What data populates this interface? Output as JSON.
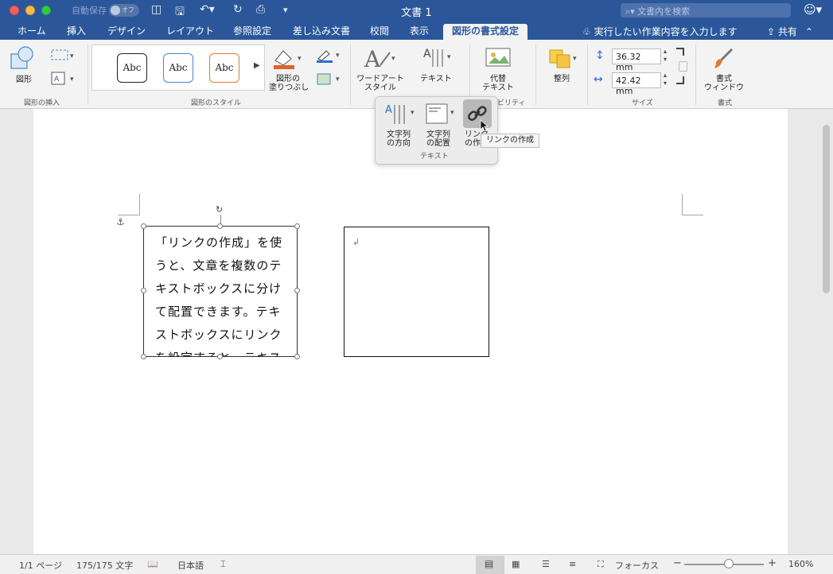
{
  "window": {
    "title": "文書 1",
    "autosave_label": "自動保存",
    "autosave_state": "オフ",
    "search_placeholder": "文書内を検索"
  },
  "tabs": [
    "ホーム",
    "挿入",
    "デザイン",
    "レイアウト",
    "参照設定",
    "差し込み文書",
    "校閲",
    "表示",
    "図形の書式設定"
  ],
  "active_tab": "図形の書式設定",
  "tell_me": "実行したい作業内容を入力します",
  "share": "共有",
  "ribbon": {
    "insert_shape": {
      "shape_label": "図形",
      "group": "図形の挿入"
    },
    "shape_styles": {
      "sample": "Abc",
      "fill_label": "図形の\n塗りつぶし",
      "group": "図形のスタイル"
    },
    "wordart_label": "ワードアート\nスタイル",
    "text_label": "テキスト",
    "alt_text_label": "代替\nテキスト",
    "accessibility_group": "ビリティ",
    "arrange_label": "整列",
    "size": {
      "height": "36.32 mm",
      "width": "42.42 mm",
      "group": "サイズ"
    },
    "format_pane": {
      "label": "書式\nウィンドウ",
      "group": "書式"
    }
  },
  "popup": {
    "direction_label": "文字列\nの方向",
    "align_label": "文字列\nの配置",
    "link_label": "リンク\nの作",
    "group": "テキスト"
  },
  "tooltip": "リンクの作成",
  "document": {
    "textbox1": "「リンクの作成」を使うと、文章を複数のテキストボックスに分けて配置できます。テキストボックスにリンクを設定すると、テキス",
    "paragraph_mark": "↲"
  },
  "status": {
    "page": "1/1 ページ",
    "words": "175/175 文字",
    "language": "日本語",
    "focus": "フォーカス",
    "zoom": "160%",
    "zoom_level_fraction": 0.56
  },
  "colors": {
    "title_blue": "#2b579a",
    "ribbon_bg": "#f3f3f3",
    "link_icon_bg": "#b8b8b8"
  }
}
